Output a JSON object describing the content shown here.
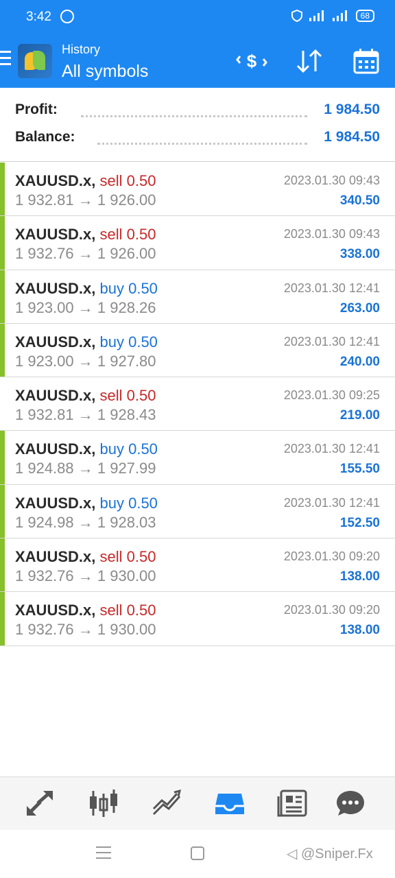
{
  "status_bar": {
    "time": "3:42",
    "battery": "68"
  },
  "toolbar": {
    "subtitle": "History",
    "title": "All symbols"
  },
  "summary": {
    "profit_label": "Profit:",
    "profit_value": "1 984.50",
    "balance_label": "Balance:",
    "balance_value": "1 984.50"
  },
  "deals": [
    {
      "symbol": "XAUUSD.x,",
      "side": "sell",
      "volume": "0.50",
      "price_open": "1 932.81",
      "price_close": "1 926.00",
      "time": "2023.01.30 09:43",
      "profit": "340.50",
      "highlight": true
    },
    {
      "symbol": "XAUUSD.x,",
      "side": "sell",
      "volume": "0.50",
      "price_open": "1 932.76",
      "price_close": "1 926.00",
      "time": "2023.01.30 09:43",
      "profit": "338.00",
      "highlight": true
    },
    {
      "symbol": "XAUUSD.x,",
      "side": "buy",
      "volume": "0.50",
      "price_open": "1 923.00",
      "price_close": "1 928.26",
      "time": "2023.01.30 12:41",
      "profit": "263.00",
      "highlight": true
    },
    {
      "symbol": "XAUUSD.x,",
      "side": "buy",
      "volume": "0.50",
      "price_open": "1 923.00",
      "price_close": "1 927.80",
      "time": "2023.01.30 12:41",
      "profit": "240.00",
      "highlight": true
    },
    {
      "symbol": "XAUUSD.x,",
      "side": "sell",
      "volume": "0.50",
      "price_open": "1 932.81",
      "price_close": "1 928.43",
      "time": "2023.01.30 09:25",
      "profit": "219.00",
      "highlight": false
    },
    {
      "symbol": "XAUUSD.x,",
      "side": "buy",
      "volume": "0.50",
      "price_open": "1 924.88",
      "price_close": "1 927.99",
      "time": "2023.01.30 12:41",
      "profit": "155.50",
      "highlight": true
    },
    {
      "symbol": "XAUUSD.x,",
      "side": "buy",
      "volume": "0.50",
      "price_open": "1 924.98",
      "price_close": "1 928.03",
      "time": "2023.01.30 12:41",
      "profit": "152.50",
      "highlight": true
    },
    {
      "symbol": "XAUUSD.x,",
      "side": "sell",
      "volume": "0.50",
      "price_open": "1 932.76",
      "price_close": "1 930.00",
      "time": "2023.01.30 09:20",
      "profit": "138.00",
      "highlight": true
    },
    {
      "symbol": "XAUUSD.x,",
      "side": "sell",
      "volume": "0.50",
      "price_open": "1 932.76",
      "price_close": "1 930.00",
      "time": "2023.01.30 09:20",
      "profit": "138.00",
      "highlight": true
    }
  ],
  "arrow": "→",
  "watermark": "@Sniper.Fx",
  "colors": {
    "primary": "#1e88f2",
    "sell": "#c62828",
    "buy": "#1a73d6",
    "profit": "#1a73d6",
    "highlight_bar": "#86c02a"
  },
  "icons": {
    "toolbar": [
      "deposit-exchange-icon",
      "sort-icon",
      "calendar-icon"
    ],
    "nav": [
      "trade-arrows-icon",
      "candlestick-icon",
      "chart-trend-icon",
      "history-inbox-icon",
      "news-icon",
      "chat-icon"
    ],
    "nav_active": "history-inbox-icon"
  }
}
